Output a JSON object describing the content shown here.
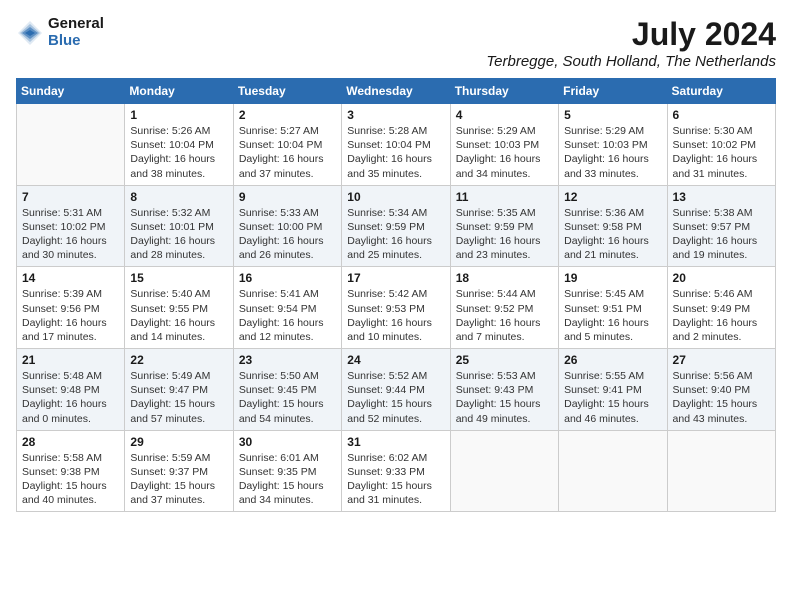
{
  "header": {
    "logo_general": "General",
    "logo_blue": "Blue",
    "month_title": "July 2024",
    "location": "Terbregge, South Holland, The Netherlands"
  },
  "weekdays": [
    "Sunday",
    "Monday",
    "Tuesday",
    "Wednesday",
    "Thursday",
    "Friday",
    "Saturday"
  ],
  "weeks": [
    [
      {
        "day": "",
        "info": ""
      },
      {
        "day": "1",
        "info": "Sunrise: 5:26 AM\nSunset: 10:04 PM\nDaylight: 16 hours\nand 38 minutes."
      },
      {
        "day": "2",
        "info": "Sunrise: 5:27 AM\nSunset: 10:04 PM\nDaylight: 16 hours\nand 37 minutes."
      },
      {
        "day": "3",
        "info": "Sunrise: 5:28 AM\nSunset: 10:04 PM\nDaylight: 16 hours\nand 35 minutes."
      },
      {
        "day": "4",
        "info": "Sunrise: 5:29 AM\nSunset: 10:03 PM\nDaylight: 16 hours\nand 34 minutes."
      },
      {
        "day": "5",
        "info": "Sunrise: 5:29 AM\nSunset: 10:03 PM\nDaylight: 16 hours\nand 33 minutes."
      },
      {
        "day": "6",
        "info": "Sunrise: 5:30 AM\nSunset: 10:02 PM\nDaylight: 16 hours\nand 31 minutes."
      }
    ],
    [
      {
        "day": "7",
        "info": "Sunrise: 5:31 AM\nSunset: 10:02 PM\nDaylight: 16 hours\nand 30 minutes."
      },
      {
        "day": "8",
        "info": "Sunrise: 5:32 AM\nSunset: 10:01 PM\nDaylight: 16 hours\nand 28 minutes."
      },
      {
        "day": "9",
        "info": "Sunrise: 5:33 AM\nSunset: 10:00 PM\nDaylight: 16 hours\nand 26 minutes."
      },
      {
        "day": "10",
        "info": "Sunrise: 5:34 AM\nSunset: 9:59 PM\nDaylight: 16 hours\nand 25 minutes."
      },
      {
        "day": "11",
        "info": "Sunrise: 5:35 AM\nSunset: 9:59 PM\nDaylight: 16 hours\nand 23 minutes."
      },
      {
        "day": "12",
        "info": "Sunrise: 5:36 AM\nSunset: 9:58 PM\nDaylight: 16 hours\nand 21 minutes."
      },
      {
        "day": "13",
        "info": "Sunrise: 5:38 AM\nSunset: 9:57 PM\nDaylight: 16 hours\nand 19 minutes."
      }
    ],
    [
      {
        "day": "14",
        "info": "Sunrise: 5:39 AM\nSunset: 9:56 PM\nDaylight: 16 hours\nand 17 minutes."
      },
      {
        "day": "15",
        "info": "Sunrise: 5:40 AM\nSunset: 9:55 PM\nDaylight: 16 hours\nand 14 minutes."
      },
      {
        "day": "16",
        "info": "Sunrise: 5:41 AM\nSunset: 9:54 PM\nDaylight: 16 hours\nand 12 minutes."
      },
      {
        "day": "17",
        "info": "Sunrise: 5:42 AM\nSunset: 9:53 PM\nDaylight: 16 hours\nand 10 minutes."
      },
      {
        "day": "18",
        "info": "Sunrise: 5:44 AM\nSunset: 9:52 PM\nDaylight: 16 hours\nand 7 minutes."
      },
      {
        "day": "19",
        "info": "Sunrise: 5:45 AM\nSunset: 9:51 PM\nDaylight: 16 hours\nand 5 minutes."
      },
      {
        "day": "20",
        "info": "Sunrise: 5:46 AM\nSunset: 9:49 PM\nDaylight: 16 hours\nand 2 minutes."
      }
    ],
    [
      {
        "day": "21",
        "info": "Sunrise: 5:48 AM\nSunset: 9:48 PM\nDaylight: 16 hours\nand 0 minutes."
      },
      {
        "day": "22",
        "info": "Sunrise: 5:49 AM\nSunset: 9:47 PM\nDaylight: 15 hours\nand 57 minutes."
      },
      {
        "day": "23",
        "info": "Sunrise: 5:50 AM\nSunset: 9:45 PM\nDaylight: 15 hours\nand 54 minutes."
      },
      {
        "day": "24",
        "info": "Sunrise: 5:52 AM\nSunset: 9:44 PM\nDaylight: 15 hours\nand 52 minutes."
      },
      {
        "day": "25",
        "info": "Sunrise: 5:53 AM\nSunset: 9:43 PM\nDaylight: 15 hours\nand 49 minutes."
      },
      {
        "day": "26",
        "info": "Sunrise: 5:55 AM\nSunset: 9:41 PM\nDaylight: 15 hours\nand 46 minutes."
      },
      {
        "day": "27",
        "info": "Sunrise: 5:56 AM\nSunset: 9:40 PM\nDaylight: 15 hours\nand 43 minutes."
      }
    ],
    [
      {
        "day": "28",
        "info": "Sunrise: 5:58 AM\nSunset: 9:38 PM\nDaylight: 15 hours\nand 40 minutes."
      },
      {
        "day": "29",
        "info": "Sunrise: 5:59 AM\nSunset: 9:37 PM\nDaylight: 15 hours\nand 37 minutes."
      },
      {
        "day": "30",
        "info": "Sunrise: 6:01 AM\nSunset: 9:35 PM\nDaylight: 15 hours\nand 34 minutes."
      },
      {
        "day": "31",
        "info": "Sunrise: 6:02 AM\nSunset: 9:33 PM\nDaylight: 15 hours\nand 31 minutes."
      },
      {
        "day": "",
        "info": ""
      },
      {
        "day": "",
        "info": ""
      },
      {
        "day": "",
        "info": ""
      }
    ]
  ]
}
